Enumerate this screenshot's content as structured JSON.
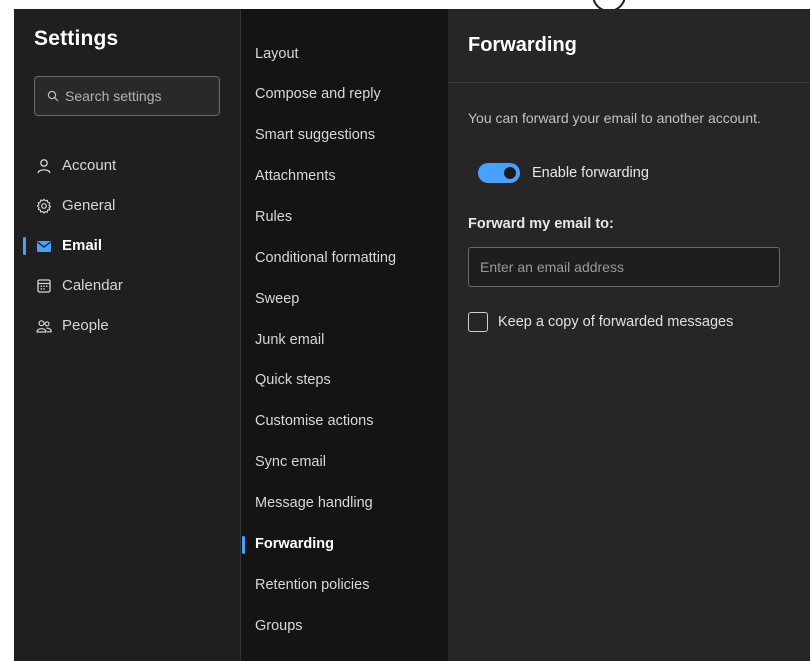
{
  "nav": {
    "title": "Settings",
    "search_placeholder": "Search settings",
    "items": [
      {
        "label": "Account",
        "icon": "person-icon",
        "active": false
      },
      {
        "label": "General",
        "icon": "gear-icon",
        "active": false
      },
      {
        "label": "Email",
        "icon": "mail-icon",
        "active": true
      },
      {
        "label": "Calendar",
        "icon": "calendar-icon",
        "active": false
      },
      {
        "label": "People",
        "icon": "people-icon",
        "active": false
      }
    ]
  },
  "email_settings": {
    "items": [
      {
        "label": "Layout",
        "active": false
      },
      {
        "label": "Compose and reply",
        "active": false
      },
      {
        "label": "Smart suggestions",
        "active": false
      },
      {
        "label": "Attachments",
        "active": false
      },
      {
        "label": "Rules",
        "active": false
      },
      {
        "label": "Conditional formatting",
        "active": false
      },
      {
        "label": "Sweep",
        "active": false
      },
      {
        "label": "Junk email",
        "active": false
      },
      {
        "label": "Quick steps",
        "active": false
      },
      {
        "label": "Customise actions",
        "active": false
      },
      {
        "label": "Sync email",
        "active": false
      },
      {
        "label": "Message handling",
        "active": false
      },
      {
        "label": "Forwarding",
        "active": true
      },
      {
        "label": "Retention policies",
        "active": false
      },
      {
        "label": "Groups",
        "active": false
      }
    ]
  },
  "forwarding": {
    "title": "Forwarding",
    "description": "You can forward your email to another account.",
    "toggle_label": "Enable forwarding",
    "toggle_on": true,
    "field_label": "Forward my email to:",
    "email_placeholder": "Enter an email address",
    "email_value": "",
    "keep_copy_label": "Keep a copy of forwarded messages",
    "keep_copy_checked": false
  },
  "colors": {
    "accent": "#4aa0ff",
    "nav_bg": "#1f1f1f",
    "middle_bg": "#141414",
    "pane_bg": "#262626"
  }
}
